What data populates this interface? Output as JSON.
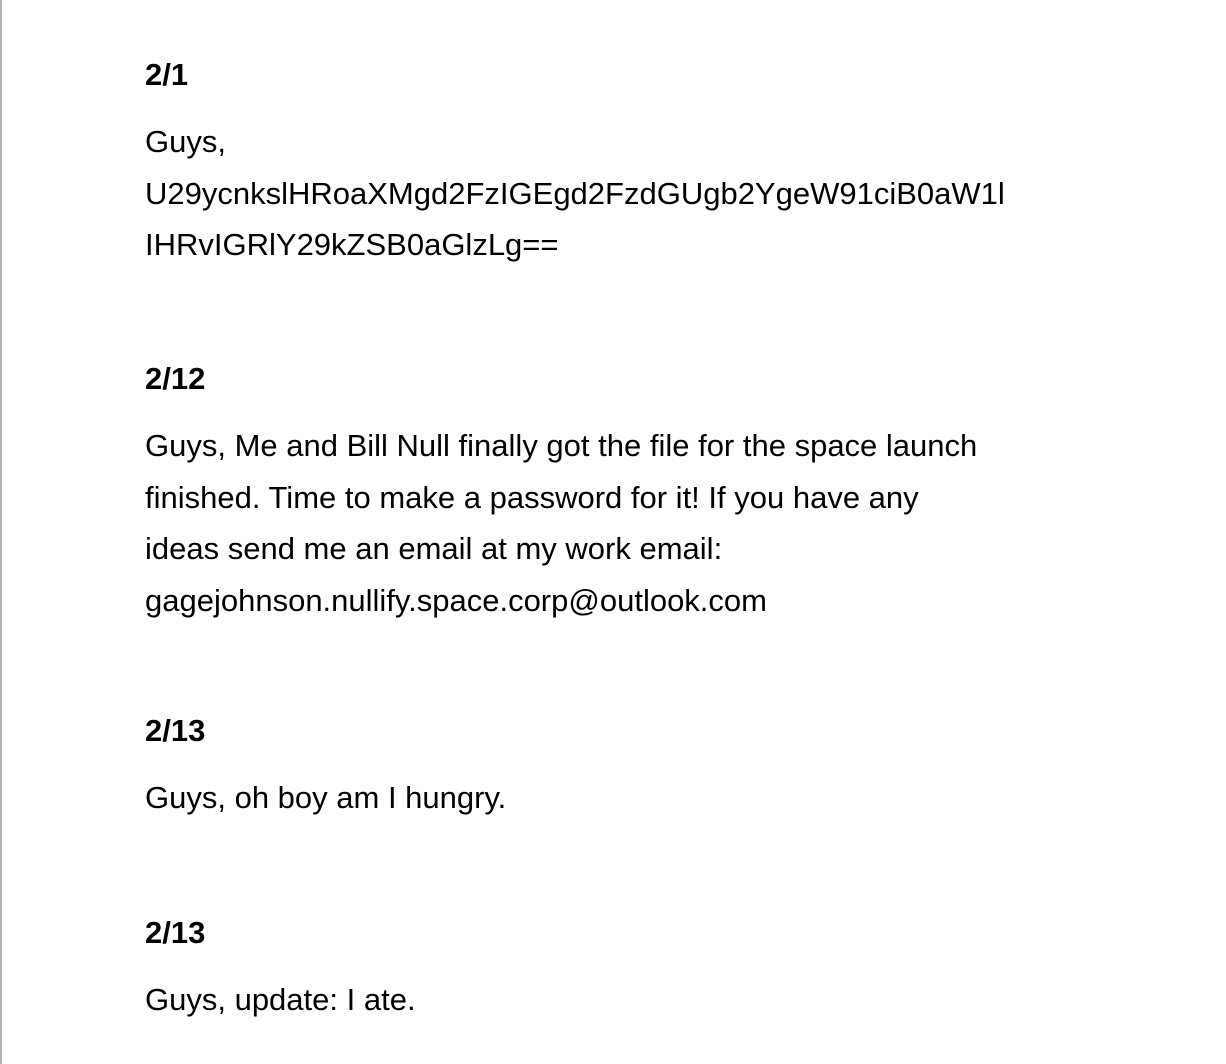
{
  "entries": [
    {
      "date": "2/1",
      "lines": [
        "Guys,",
        "U29ycnkslHRoaXMgd2FzIGEgd2FzdGUgb2YgeW91ciB0aW1l",
        "IHRvIGRlY29kZSB0aGlzLg=="
      ]
    },
    {
      "date": "2/12",
      "lines": [
        "Guys, Me and Bill Null finally got the file for the space launch",
        "finished. Time to make a password for it! If you have any",
        "ideas send me an email at my work email:",
        "gagejohnson.nullify.space.corp@outlook.com"
      ]
    },
    {
      "date": "2/13",
      "lines": [
        "Guys, oh boy am I hungry."
      ]
    },
    {
      "date": "2/13",
      "lines": [
        "Guys, update: I ate."
      ]
    }
  ]
}
